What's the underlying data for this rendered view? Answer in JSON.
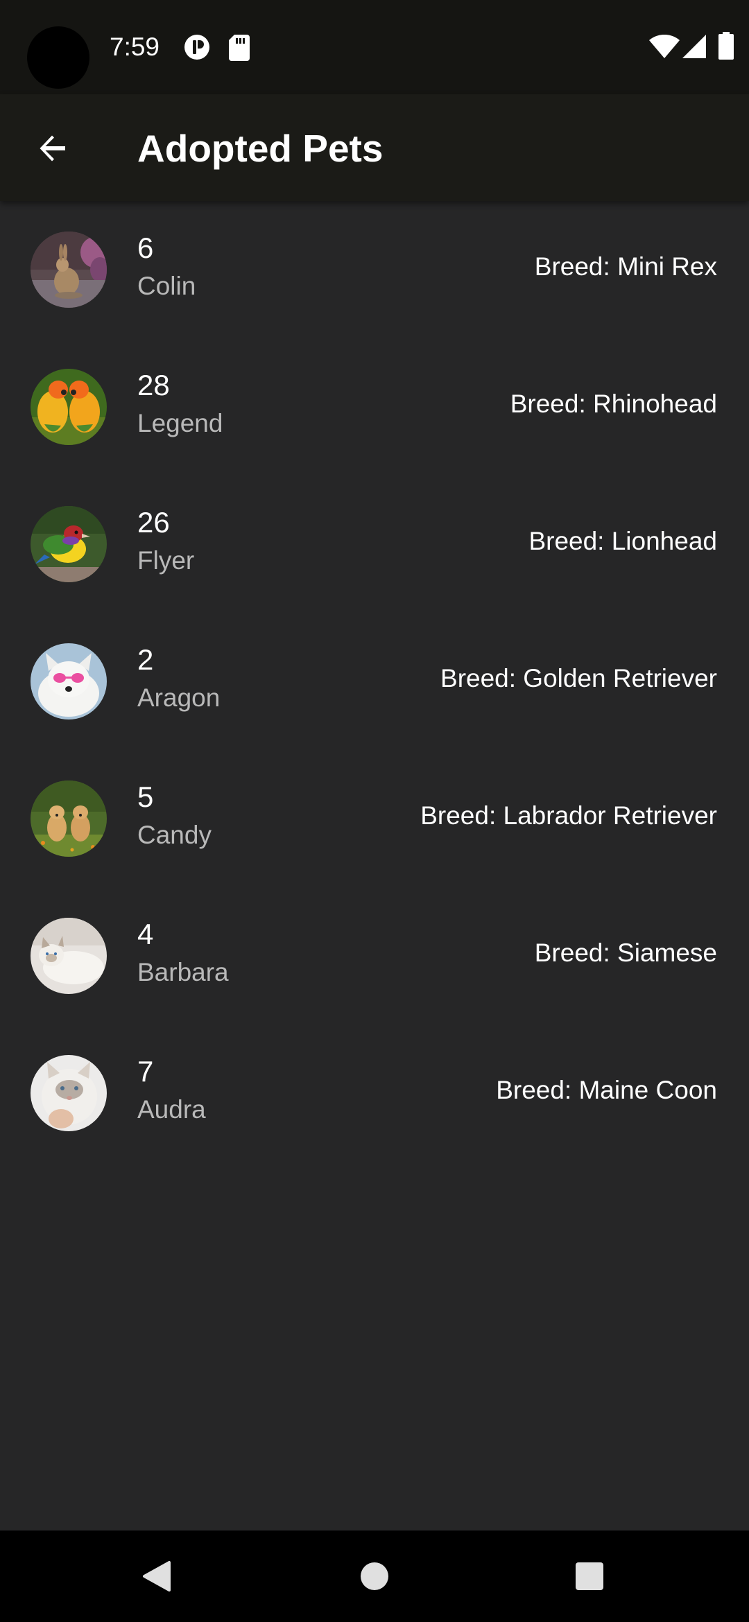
{
  "status_bar": {
    "time": "7:59"
  },
  "app_bar": {
    "title": "Adopted Pets"
  },
  "pets": [
    {
      "id": "6",
      "name": "Colin",
      "breed": "Breed: Mini Rex",
      "avatar": "rabbit"
    },
    {
      "id": "28",
      "name": "Legend",
      "breed": "Breed: Rhinohead",
      "avatar": "parrots"
    },
    {
      "id": "26",
      "name": "Flyer",
      "breed": "Breed: Lionhead",
      "avatar": "finch"
    },
    {
      "id": "2",
      "name": "Aragon",
      "breed": "Breed: Golden Retriever",
      "avatar": "white-dog"
    },
    {
      "id": "5",
      "name": "Candy",
      "breed": "Breed: Labrador Retriever",
      "avatar": "puppies"
    },
    {
      "id": "4",
      "name": "Barbara",
      "breed": "Breed: Siamese",
      "avatar": "white-cat"
    },
    {
      "id": "7",
      "name": "Audra",
      "breed": "Breed: Maine Coon",
      "avatar": "fluffy-cat"
    }
  ],
  "icons": {
    "back": "arrow-back-icon",
    "nav_back": "triangle-back-icon",
    "nav_home": "circle-home-icon",
    "nav_recents": "square-recents-icon"
  }
}
